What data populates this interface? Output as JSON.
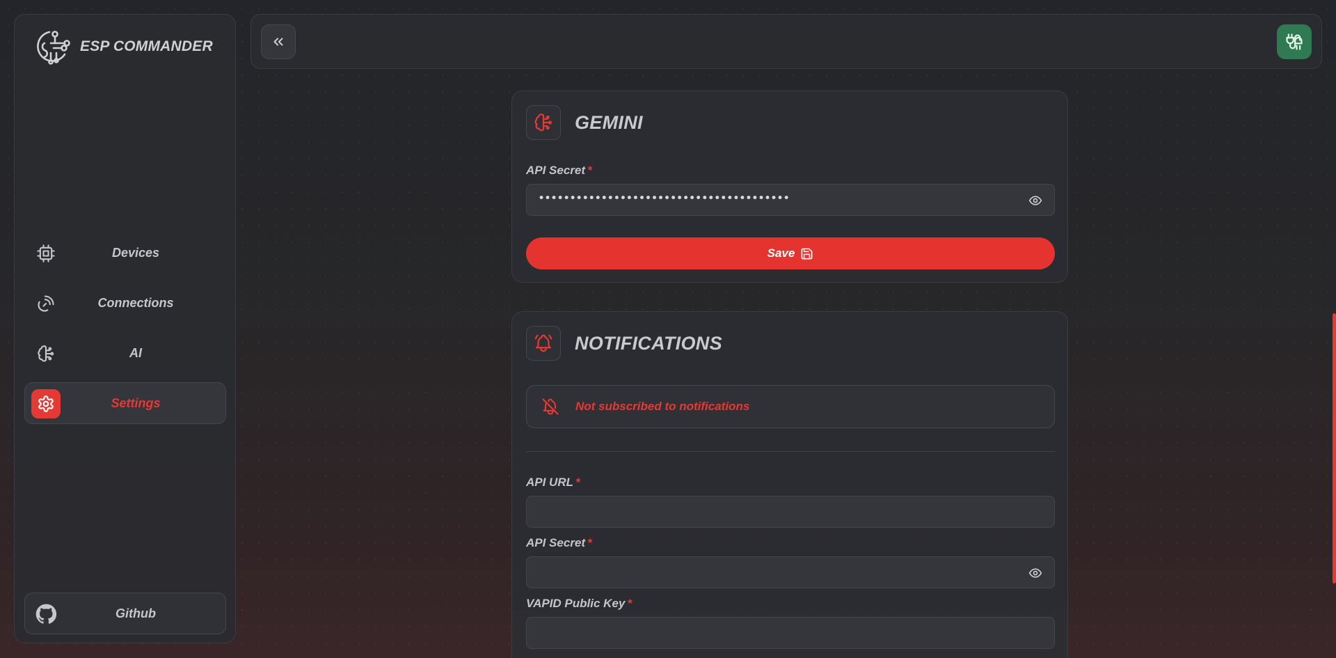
{
  "app": {
    "name": "ESP COMMANDER"
  },
  "sidebar": {
    "items": [
      {
        "label": "Devices",
        "icon": "chip-icon"
      },
      {
        "label": "Connections",
        "icon": "satellite-dish-icon"
      },
      {
        "label": "AI",
        "icon": "brain-icon"
      },
      {
        "label": "Settings",
        "icon": "gear-icon",
        "active": true
      }
    ],
    "footer": {
      "label": "Github",
      "icon": "github-icon"
    }
  },
  "topbar": {
    "collapse_icon": "chevrons-left-icon",
    "connection_icon": "plug-connected-icon",
    "connection_color": "#2f7a52"
  },
  "gemini": {
    "title": "GEMINI",
    "api_secret_label": "API Secret",
    "required_mark": "*",
    "api_secret_value": "••••••••••••••••••••••••••••••••••••••••",
    "save_label": "Save"
  },
  "notifications": {
    "title": "NOTIFICATIONS",
    "status_text": "Not subscribed to notifications",
    "api_url_label": "API URL",
    "api_url_value": "",
    "api_secret_label": "API Secret",
    "api_secret_value": "",
    "vapid_label": "VAPID Public Key",
    "vapid_value": "",
    "required_mark": "*"
  },
  "colors": {
    "accent": "#e53935",
    "background": "#242529",
    "card": "#2b2c31"
  }
}
